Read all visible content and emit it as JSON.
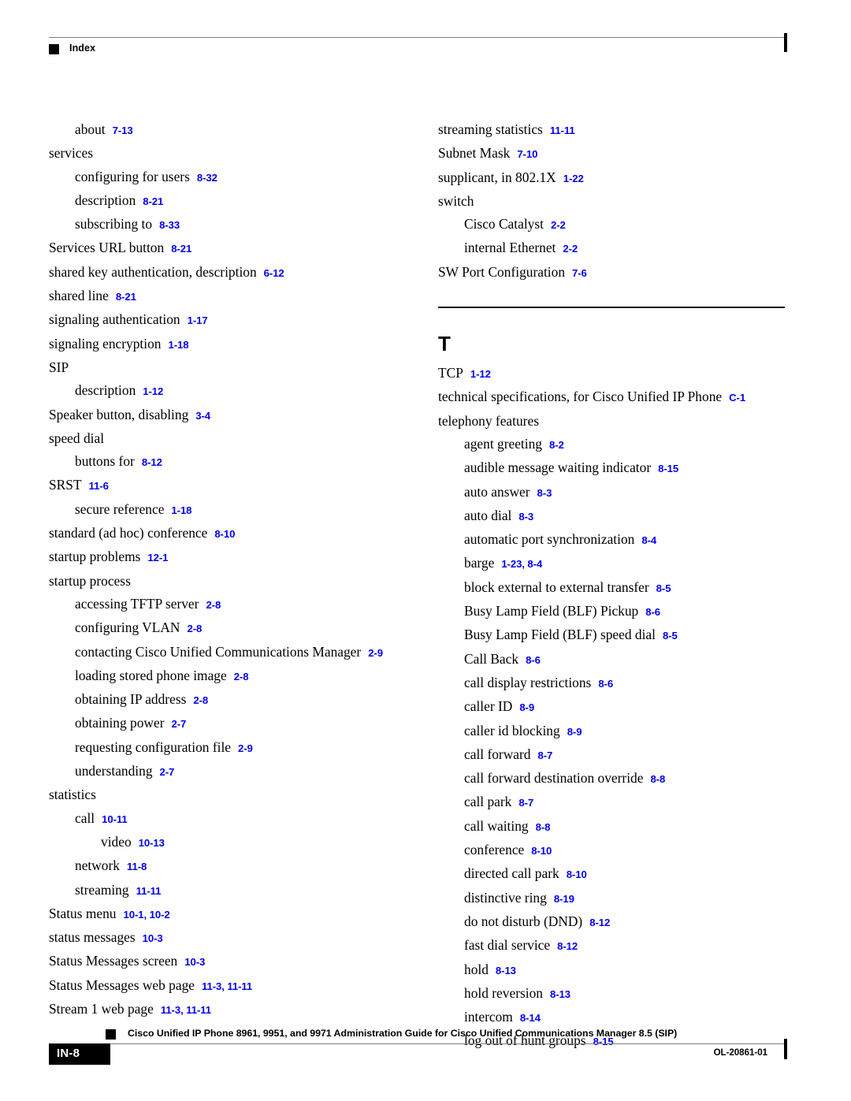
{
  "header": {
    "title": "Index",
    "marker_icon": "black-square-icon"
  },
  "columns": {
    "left": [
      {
        "level": 1,
        "term": "about",
        "pages": "7-13"
      },
      {
        "level": 0,
        "term": "services",
        "pages": ""
      },
      {
        "level": 1,
        "term": "configuring for users",
        "pages": "8-32"
      },
      {
        "level": 1,
        "term": "description",
        "pages": "8-21"
      },
      {
        "level": 1,
        "term": "subscribing to",
        "pages": "8-33"
      },
      {
        "level": 0,
        "term": "Services URL button",
        "pages": "8-21"
      },
      {
        "level": 0,
        "term": "shared key authentication, description",
        "pages": "6-12"
      },
      {
        "level": 0,
        "term": "shared line",
        "pages": "8-21"
      },
      {
        "level": 0,
        "term": "signaling authentication",
        "pages": "1-17"
      },
      {
        "level": 0,
        "term": "signaling encryption",
        "pages": "1-18"
      },
      {
        "level": 0,
        "term": "SIP",
        "pages": ""
      },
      {
        "level": 1,
        "term": "description",
        "pages": "1-12"
      },
      {
        "level": 0,
        "term": "Speaker button, disabling",
        "pages": "3-4"
      },
      {
        "level": 0,
        "term": "speed dial",
        "pages": ""
      },
      {
        "level": 1,
        "term": "buttons for",
        "pages": "8-12"
      },
      {
        "level": 0,
        "term": "SRST",
        "pages": "11-6"
      },
      {
        "level": 1,
        "term": "secure reference",
        "pages": "1-18"
      },
      {
        "level": 0,
        "term": "standard (ad hoc) conference",
        "pages": "8-10"
      },
      {
        "level": 0,
        "term": "startup problems",
        "pages": "12-1"
      },
      {
        "level": 0,
        "term": "startup process",
        "pages": ""
      },
      {
        "level": 1,
        "term": "accessing TFTP server",
        "pages": "2-8"
      },
      {
        "level": 1,
        "term": "configuring VLAN",
        "pages": "2-8"
      },
      {
        "level": 1,
        "term": "contacting Cisco Unified Communications Manager",
        "pages": "2-9"
      },
      {
        "level": 1,
        "term": "loading stored phone image",
        "pages": "2-8"
      },
      {
        "level": 1,
        "term": "obtaining IP address",
        "pages": "2-8"
      },
      {
        "level": 1,
        "term": "obtaining power",
        "pages": "2-7"
      },
      {
        "level": 1,
        "term": "requesting configuration file",
        "pages": "2-9"
      },
      {
        "level": 1,
        "term": "understanding",
        "pages": "2-7"
      },
      {
        "level": 0,
        "term": "statistics",
        "pages": ""
      },
      {
        "level": 1,
        "term": "call",
        "pages": "10-11"
      },
      {
        "level": 2,
        "term": "video",
        "pages": "10-13"
      },
      {
        "level": 1,
        "term": "network",
        "pages": "11-8"
      },
      {
        "level": 1,
        "term": "streaming",
        "pages": "11-11"
      },
      {
        "level": 0,
        "term": "Status menu",
        "pages": "10-1, 10-2"
      },
      {
        "level": 0,
        "term": "status messages",
        "pages": "10-3"
      },
      {
        "level": 0,
        "term": "Status Messages screen",
        "pages": "10-3"
      },
      {
        "level": 0,
        "term": "Status Messages web page",
        "pages": "11-3, 11-11"
      },
      {
        "level": 0,
        "term": "Stream 1 web page",
        "pages": "11-3, 11-11"
      }
    ],
    "right_before_section": [
      {
        "level": 0,
        "term": "streaming statistics",
        "pages": "11-11"
      },
      {
        "level": 0,
        "term": "Subnet Mask",
        "pages": "7-10"
      },
      {
        "level": 0,
        "term": "supplicant, in 802.1X",
        "pages": "1-22"
      },
      {
        "level": 0,
        "term": "switch",
        "pages": ""
      },
      {
        "level": 1,
        "term": "Cisco Catalyst",
        "pages": "2-2"
      },
      {
        "level": 1,
        "term": "internal Ethernet",
        "pages": "2-2"
      },
      {
        "level": 0,
        "term": "SW Port Configuration",
        "pages": "7-6"
      }
    ],
    "section_letter": "T",
    "right_after_section": [
      {
        "level": 0,
        "term": "TCP",
        "pages": "1-12"
      },
      {
        "level": 0,
        "term": "technical specifications, for Cisco Unified IP Phone",
        "pages": "C-1"
      },
      {
        "level": 0,
        "term": "telephony features",
        "pages": ""
      },
      {
        "level": 1,
        "term": "agent greeting",
        "pages": "8-2"
      },
      {
        "level": 1,
        "term": "audible message waiting indicator",
        "pages": "8-15"
      },
      {
        "level": 1,
        "term": "auto answer",
        "pages": "8-3"
      },
      {
        "level": 1,
        "term": "auto dial",
        "pages": "8-3"
      },
      {
        "level": 1,
        "term": "automatic port synchronization",
        "pages": "8-4"
      },
      {
        "level": 1,
        "term": "barge",
        "pages": "1-23, 8-4"
      },
      {
        "level": 1,
        "term": "block external to external transfer",
        "pages": "8-5"
      },
      {
        "level": 1,
        "term": "Busy Lamp Field (BLF) Pickup",
        "pages": "8-6"
      },
      {
        "level": 1,
        "term": "Busy Lamp Field (BLF) speed dial",
        "pages": "8-5"
      },
      {
        "level": 1,
        "term": "Call Back",
        "pages": "8-6"
      },
      {
        "level": 1,
        "term": "call display restrictions",
        "pages": "8-6"
      },
      {
        "level": 1,
        "term": "caller ID",
        "pages": "8-9"
      },
      {
        "level": 1,
        "term": "caller id blocking",
        "pages": "8-9"
      },
      {
        "level": 1,
        "term": "call forward",
        "pages": "8-7"
      },
      {
        "level": 1,
        "term": "call forward destination override",
        "pages": "8-8"
      },
      {
        "level": 1,
        "term": "call park",
        "pages": "8-7"
      },
      {
        "level": 1,
        "term": "call waiting",
        "pages": "8-8"
      },
      {
        "level": 1,
        "term": "conference",
        "pages": "8-10"
      },
      {
        "level": 1,
        "term": "directed call park",
        "pages": "8-10"
      },
      {
        "level": 1,
        "term": "distinctive ring",
        "pages": "8-19"
      },
      {
        "level": 1,
        "term": "do not disturb (DND)",
        "pages": "8-12"
      },
      {
        "level": 1,
        "term": "fast dial service",
        "pages": "8-12"
      },
      {
        "level": 1,
        "term": "hold",
        "pages": "8-13"
      },
      {
        "level": 1,
        "term": "hold reversion",
        "pages": "8-13"
      },
      {
        "level": 1,
        "term": "intercom",
        "pages": "8-14"
      },
      {
        "level": 1,
        "term": "log out of hunt groups",
        "pages": "8-15"
      }
    ]
  },
  "footer": {
    "marker_icon": "black-square-icon",
    "title": "Cisco Unified IP Phone 8961, 9951, and 9971 Administration Guide for Cisco Unified Communications Manager 8.5 (SIP)",
    "page_number": "IN-8",
    "doc_id": "OL-20861-01"
  },
  "colors": {
    "link_blue": "#0000ee",
    "rule_gray": "#7d7d7d",
    "text_black": "#000000"
  }
}
